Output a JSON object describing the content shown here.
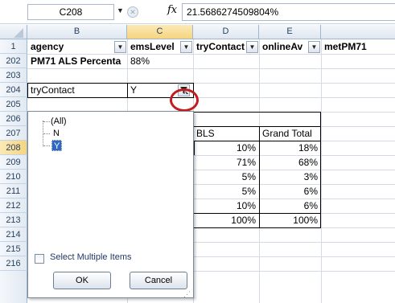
{
  "formula_bar": {
    "name_box": "C208",
    "fx": "fx",
    "value": "21.5686274509804%"
  },
  "columns": [
    "B",
    "C",
    "D",
    "E"
  ],
  "rows": [
    "1",
    "202",
    "203",
    "204",
    "205",
    "206",
    "207",
    "208",
    "209",
    "210",
    "211",
    "212",
    "213",
    "214",
    "215",
    "216"
  ],
  "header_row": {
    "b": "agency",
    "c": "emsLevel",
    "d": "tryContact",
    "e": "onlineAv",
    "f": "metPM71"
  },
  "row202": {
    "b": "PM71  ALS Percenta",
    "c": "88%"
  },
  "row204": {
    "b": "tryContact",
    "c": "Y"
  },
  "pivot": {
    "col_headers": [
      "BLS",
      "Grand Total"
    ],
    "bls": [
      "10%",
      "71%",
      "5%",
      "5%",
      "10%",
      "100%"
    ],
    "grand_total": [
      "18%",
      "68%",
      "3%",
      "6%",
      "6%",
      "100%"
    ]
  },
  "filter_popup": {
    "items": [
      "(All)",
      "N",
      "Y"
    ],
    "select_multiple_label": "Select Multiple Items",
    "ok_label": "OK",
    "cancel_label": "Cancel"
  },
  "icons": {
    "dropdown": "▼",
    "filter": "filter-funnel-icon"
  },
  "colors": {
    "highlight_circle": "#c21d1d",
    "selected_header": "#f6d57e",
    "selected_item": "#3167c4"
  }
}
